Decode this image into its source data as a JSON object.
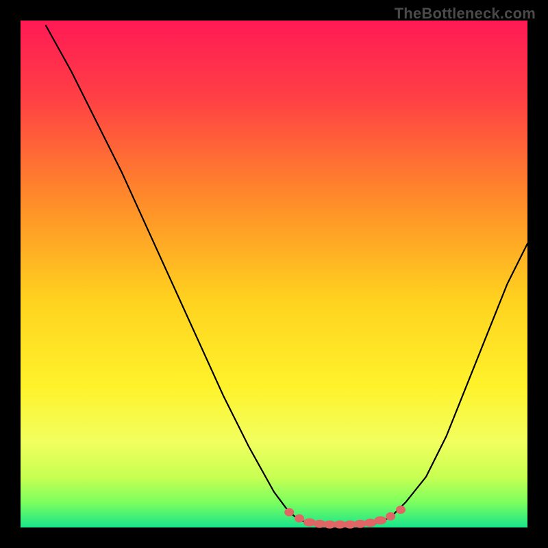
{
  "attribution": "TheBottleneck.com",
  "chart_data": {
    "type": "line",
    "title": "",
    "xlabel": "",
    "ylabel": "",
    "xlim": [
      0,
      100
    ],
    "ylim": [
      0,
      100
    ],
    "grid": false,
    "legend": false,
    "background_gradient": [
      "#ff1a4b",
      "#ff5640",
      "#ffb733",
      "#ffe627",
      "#f7ff66",
      "#9cff66",
      "#2bff7a",
      "#00e58c"
    ],
    "series": [
      {
        "name": "left-curve",
        "x": [
          5,
          10,
          15,
          20,
          25,
          30,
          35,
          40,
          45,
          50,
          53,
          55,
          57
        ],
        "y": [
          99,
          90,
          80,
          70,
          59,
          48,
          37,
          26,
          16,
          7,
          3,
          1.5,
          0.8
        ]
      },
      {
        "name": "right-curve",
        "x": [
          70,
          73,
          76,
          80,
          84,
          88,
          92,
          96,
          100
        ],
        "y": [
          0.8,
          2,
          5,
          10,
          18,
          28,
          38,
          48,
          56
        ]
      },
      {
        "name": "flat-bottom",
        "x": [
          57,
          60,
          63,
          66,
          70
        ],
        "y": [
          0.8,
          0.6,
          0.6,
          0.6,
          0.8
        ]
      }
    ],
    "markers": {
      "name": "bottom-dots",
      "color": "#e06666",
      "points": [
        {
          "x": 53,
          "y": 3.0
        },
        {
          "x": 55,
          "y": 1.8
        },
        {
          "x": 57,
          "y": 1.0
        },
        {
          "x": 59,
          "y": 0.7
        },
        {
          "x": 61,
          "y": 0.6
        },
        {
          "x": 63,
          "y": 0.6
        },
        {
          "x": 65,
          "y": 0.6
        },
        {
          "x": 67,
          "y": 0.7
        },
        {
          "x": 69,
          "y": 0.9
        },
        {
          "x": 71,
          "y": 1.4
        },
        {
          "x": 73,
          "y": 2.2
        },
        {
          "x": 75,
          "y": 3.5
        }
      ]
    }
  }
}
